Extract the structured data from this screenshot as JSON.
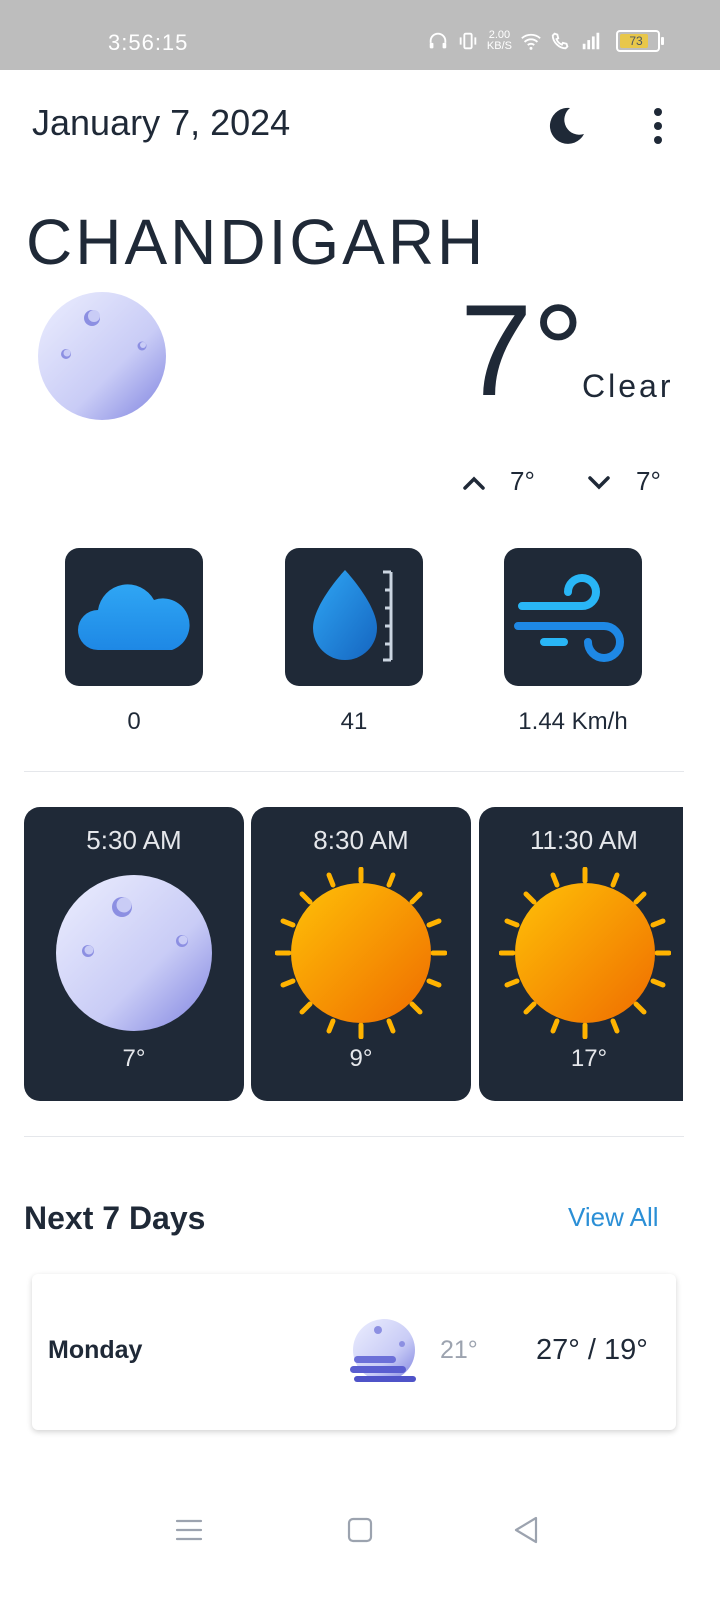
{
  "status_bar": {
    "time": "3:56:15",
    "speed_value": "2.00",
    "speed_unit": "KB/S",
    "battery": "73"
  },
  "header": {
    "date": "January 7, 2024",
    "theme_icon": "moon-icon",
    "menu_icon": "more-vertical-icon"
  },
  "current": {
    "city": "CHANDIGARH",
    "icon": "moon-icon",
    "temperature": "7°",
    "condition": "Clear",
    "high": "7°",
    "low": "7°"
  },
  "stats": [
    {
      "icon": "cloud-icon",
      "value": "0"
    },
    {
      "icon": "humidity-drop-icon",
      "value": "41"
    },
    {
      "icon": "wind-icon",
      "value": "1.44 Km/h"
    }
  ],
  "hourly": [
    {
      "time": "5:30 AM",
      "icon": "moon-icon",
      "temp": "7°"
    },
    {
      "time": "8:30 AM",
      "icon": "sun-icon",
      "temp": "9°"
    },
    {
      "time": "11:30 AM",
      "icon": "sun-icon",
      "temp": "17°"
    }
  ],
  "forecast": {
    "title": "Next 7 Days",
    "view_all": "View All",
    "days": [
      {
        "day": "Monday",
        "icon": "foggy-moon-icon",
        "feels": "21°",
        "range": "27° / 19°"
      }
    ]
  },
  "colors": {
    "accent": "#2b8fd6",
    "card_bg": "#1f2937",
    "text": "#1f2937"
  }
}
